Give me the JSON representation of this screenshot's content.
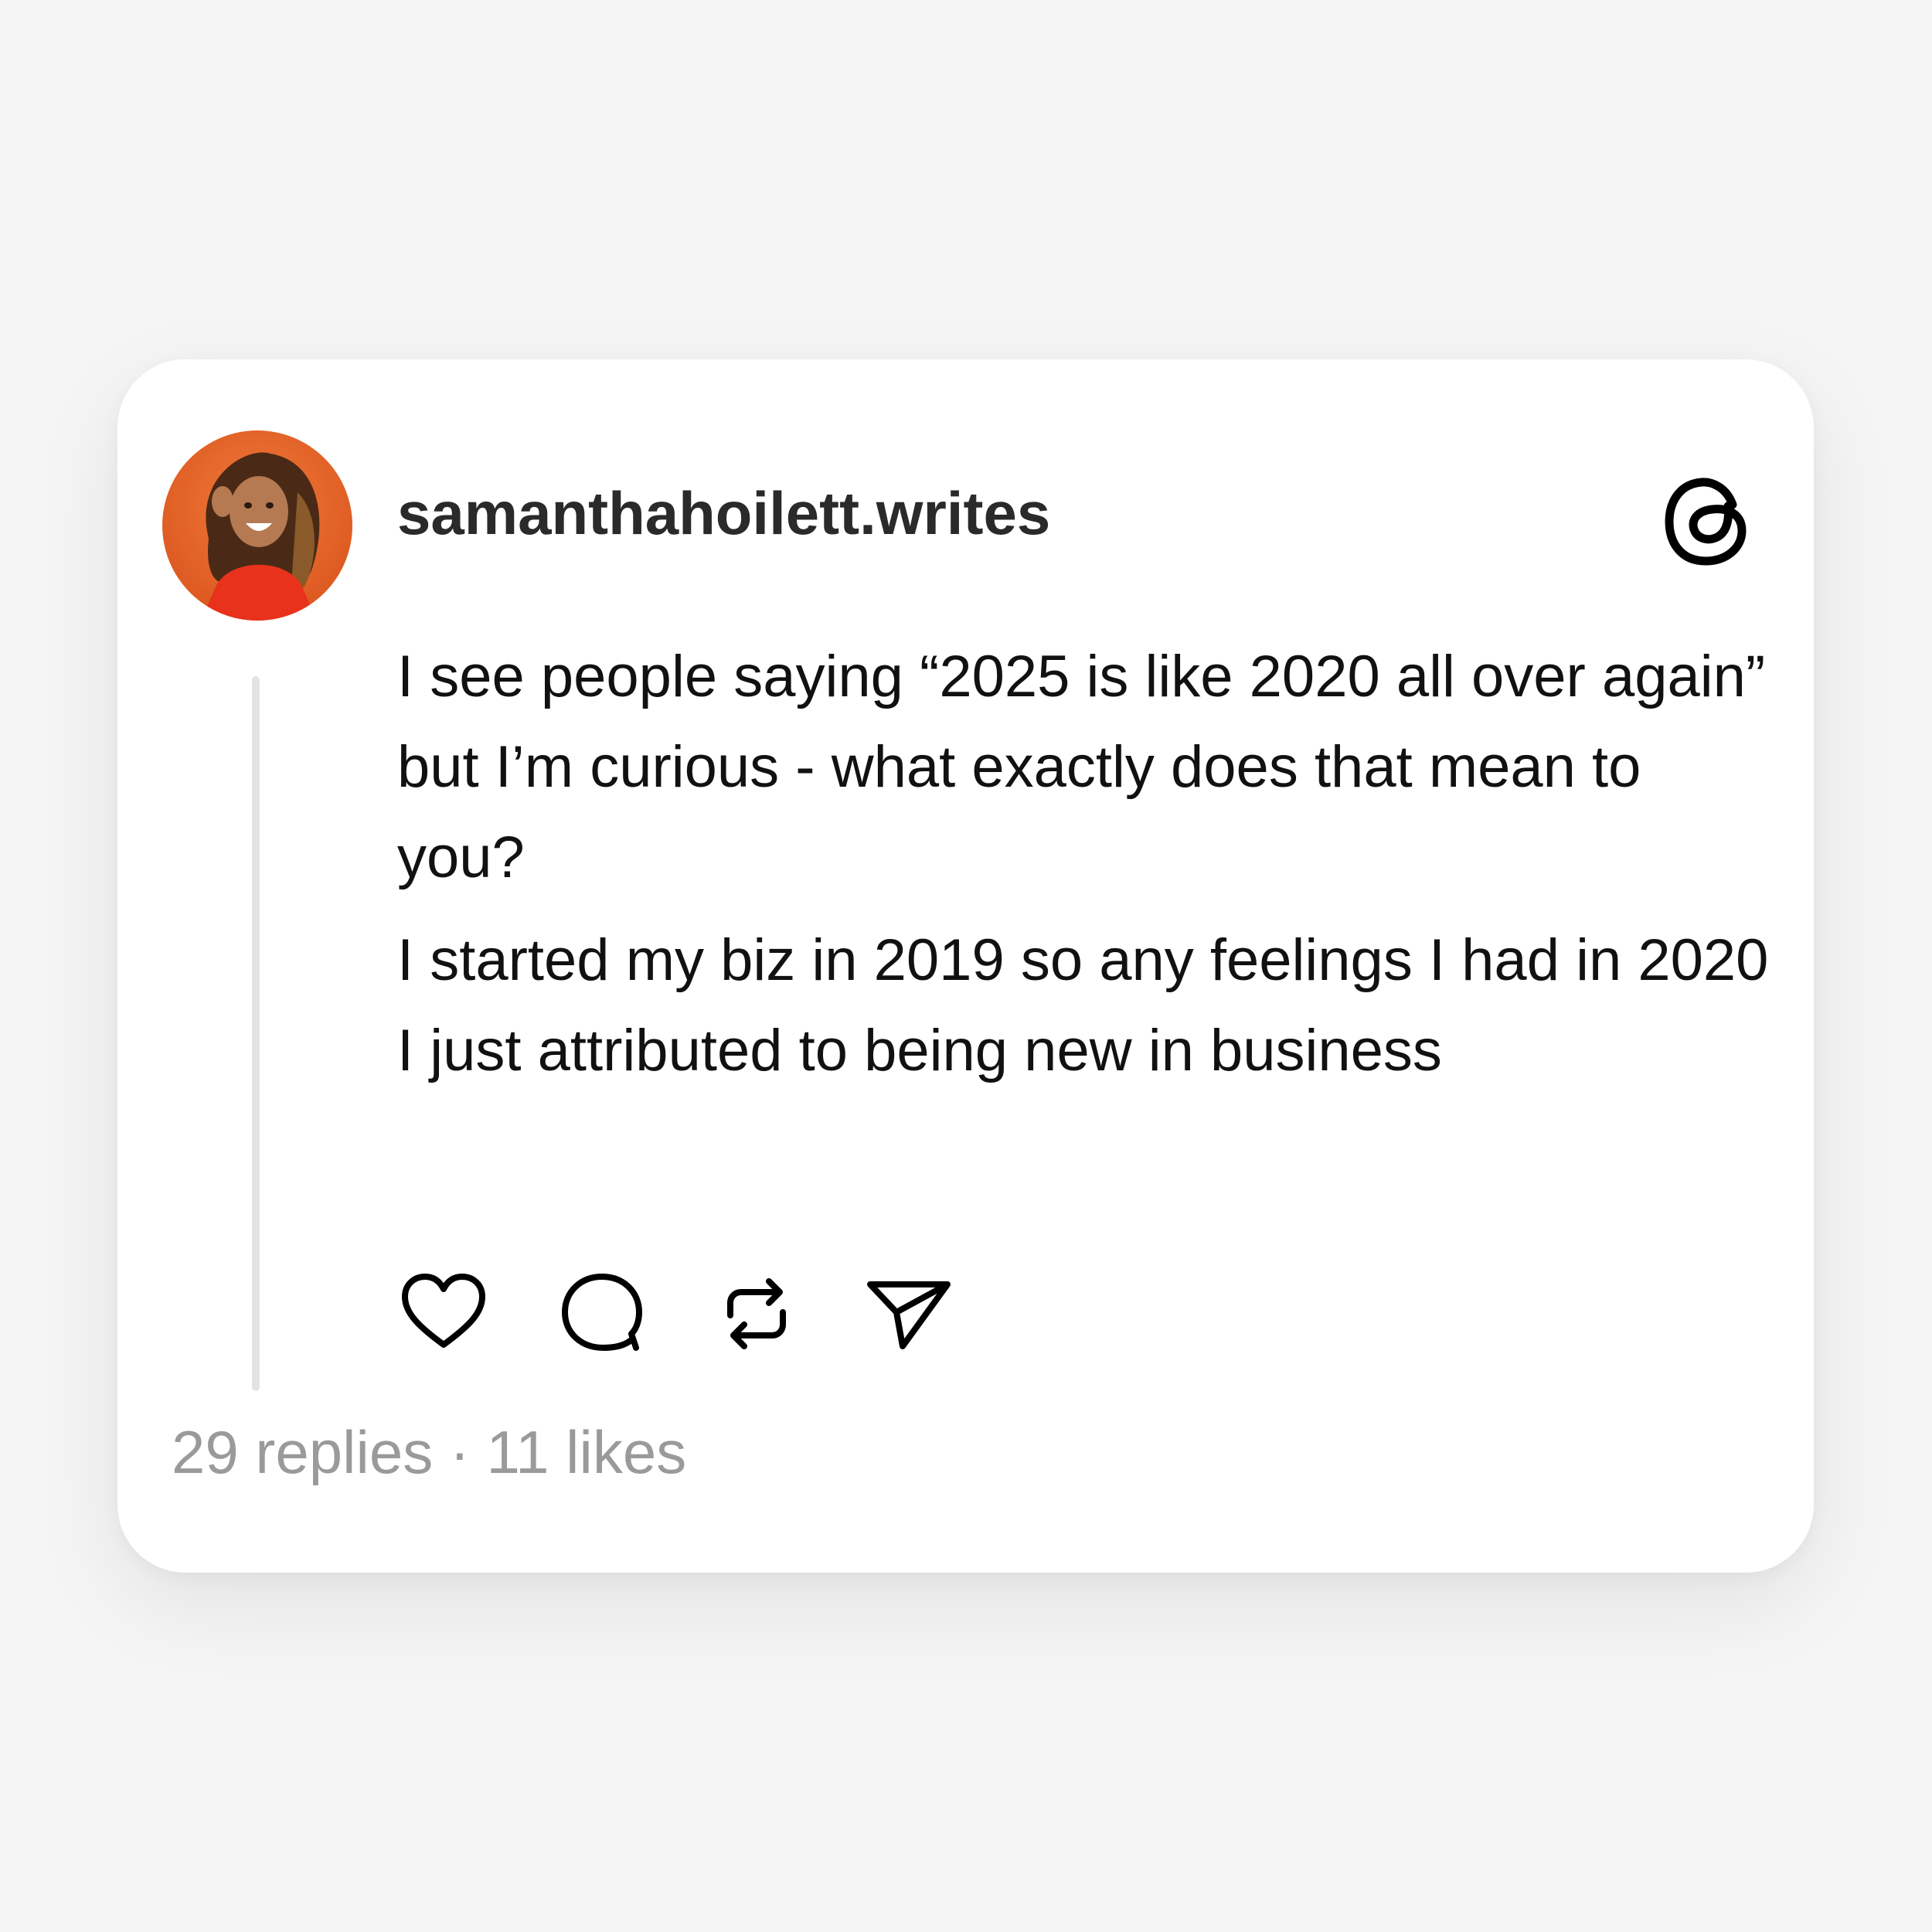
{
  "post": {
    "username": "samanthahoilett.writes",
    "paragraphs": [
      "I see people saying “2025 is like 2020 all over again” but I’m curious - what exactly does that mean to you?",
      "I started my biz in 2019 so any feelings I had in 2020 I just attributed to being new in business"
    ],
    "stats": "29 replies · 11 likes"
  },
  "icons": {
    "brand": "threads-logo-icon",
    "actions": [
      "heart-icon",
      "comment-icon",
      "repost-icon",
      "share-icon"
    ]
  },
  "colors": {
    "background": "#f5f5f5",
    "card": "#ffffff",
    "text": "#111111",
    "muted": "#9a9a9a",
    "avatar_bg": "#e8632a"
  }
}
